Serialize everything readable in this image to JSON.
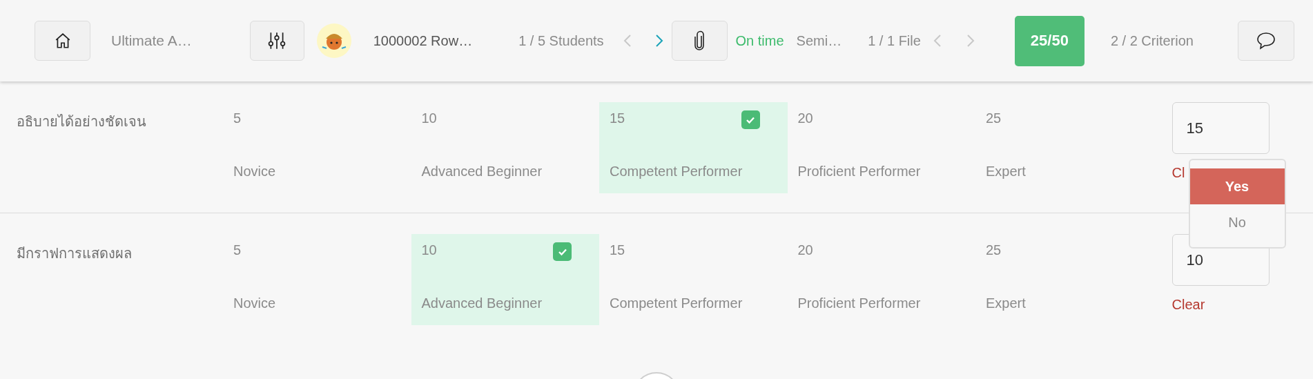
{
  "header": {
    "title": "Ultimate A…",
    "student_name": "1000002 Row…",
    "student_counter": "1 / 5 Students",
    "student_nav": [
      {
        "kind": "prev",
        "disabled": true
      },
      {
        "kind": "next",
        "disabled": false
      }
    ],
    "submission_status": "On time",
    "file_name": "Semi…",
    "file_counter": "1 / 1 File",
    "file_nav": [
      {
        "kind": "prev",
        "disabled": true
      },
      {
        "kind": "next",
        "disabled": true
      }
    ],
    "score": "25/50",
    "criterion_counter": "2 / 2 Criterion"
  },
  "criteria": [
    {
      "title": "อธิบายได้อย่างชัดเจน",
      "score": "15",
      "clear": "Cl",
      "levels": [
        {
          "points": "5",
          "label": "Novice",
          "selected": false
        },
        {
          "points": "10",
          "label": "Advanced Beginner",
          "selected": false
        },
        {
          "points": "15",
          "label": "Competent Performer",
          "selected": true
        },
        {
          "points": "20",
          "label": "Proficient Performer",
          "selected": false
        },
        {
          "points": "25",
          "label": "Expert",
          "selected": false
        }
      ]
    },
    {
      "title": "มีกราฟการแสดงผล",
      "score": "10",
      "clear": "Clear",
      "levels": [
        {
          "points": "5",
          "label": "Novice",
          "selected": false
        },
        {
          "points": "10",
          "label": "Advanced Beginner",
          "selected": true
        },
        {
          "points": "15",
          "label": "Competent Performer",
          "selected": false
        },
        {
          "points": "20",
          "label": "Proficient Performer",
          "selected": false
        },
        {
          "points": "25",
          "label": "Expert",
          "selected": false
        }
      ]
    }
  ],
  "dropdown": {
    "options": [
      {
        "label": "Yes",
        "selected": true
      },
      {
        "label": "No",
        "selected": false
      }
    ]
  }
}
